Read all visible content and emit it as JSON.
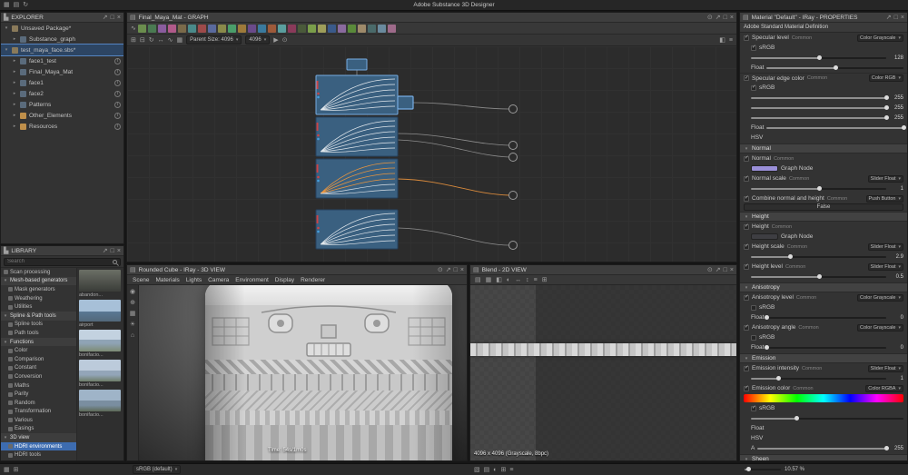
{
  "app": {
    "title": "Adobe Substance 3D Designer"
  },
  "explorer": {
    "title": "EXPLORER",
    "items": [
      {
        "label": "Unsaved Package*"
      },
      {
        "label": "Substance_graph"
      },
      {
        "label": "test_maya_face.sbs*"
      },
      {
        "label": "face1_test"
      },
      {
        "label": "Final_Maya_Mat"
      },
      {
        "label": "face1"
      },
      {
        "label": "face2"
      },
      {
        "label": "Patterns"
      },
      {
        "label": "Other_Elements"
      },
      {
        "label": "Resources"
      }
    ]
  },
  "library": {
    "title": "LIBRARY",
    "search_placeholder": "Search",
    "items": [
      {
        "label": "Scan processing"
      },
      {
        "label": "Mesh-based generators"
      },
      {
        "label": "Mask generators"
      },
      {
        "label": "Weathering"
      },
      {
        "label": "Utilities"
      },
      {
        "label": "Spline & Path tools"
      },
      {
        "label": "Spline tools"
      },
      {
        "label": "Path tools"
      },
      {
        "label": "Functions"
      },
      {
        "label": "Color"
      },
      {
        "label": "Comparison"
      },
      {
        "label": "Constant"
      },
      {
        "label": "Conversion"
      },
      {
        "label": "Maths"
      },
      {
        "label": "Parity"
      },
      {
        "label": "Random"
      },
      {
        "label": "Transformation"
      },
      {
        "label": "Various"
      },
      {
        "label": "Easings"
      },
      {
        "label": "3D view"
      },
      {
        "label": "HDRI environments"
      },
      {
        "label": "HDRI tools"
      }
    ],
    "thumbs": [
      {
        "label": "abandon..."
      },
      {
        "label": "airport"
      },
      {
        "label": "bonifacio..."
      },
      {
        "label": "bonifacio..."
      },
      {
        "label": "bonifacio..."
      }
    ]
  },
  "graph": {
    "tab_title": "Final_Maya_Mat - GRAPH",
    "parent_size_label": "Parent Size: 4096",
    "size_value": "4096"
  },
  "view3d": {
    "tab_title": "Rounded Cube - IRay - 3D VIEW",
    "menus": [
      {
        "label": "Scene"
      },
      {
        "label": "Materials"
      },
      {
        "label": "Lights"
      },
      {
        "label": "Camera"
      },
      {
        "label": "Environment"
      },
      {
        "label": "Display"
      },
      {
        "label": "Renderer"
      }
    ],
    "time_label": "Time: 54s/1m0s"
  },
  "view2d": {
    "tab_title": "Blend - 2D VIEW",
    "status": "4096 x 4096 (Grayscale, 8bpc)"
  },
  "properties": {
    "title": "Material \"Default\" - IRay - PROPERTIES",
    "subtitle": "Adobe Standard Material Definition",
    "labels": {
      "common": "Common",
      "srgb": "sRGB",
      "float": "Float",
      "hsv": "HSV",
      "alpha": "A"
    },
    "specular_level": {
      "label": "Specular level",
      "widget": "Color Grayscale",
      "value": "128"
    },
    "specular_edge": {
      "label": "Specular edge color",
      "widget": "Color RGB",
      "r": "255",
      "g": "255",
      "b": "255"
    },
    "normal_section": {
      "label": "Normal"
    },
    "normal": {
      "label": "Normal",
      "node": "Graph Node"
    },
    "normal_scale": {
      "label": "Normal scale",
      "widget": "Slider Float",
      "value": "1"
    },
    "combine": {
      "label": "Combine normal and height",
      "widget": "Push Button",
      "button": "False"
    },
    "height_section": {
      "label": "Height"
    },
    "height": {
      "label": "Height",
      "node": "Graph Node"
    },
    "height_scale": {
      "label": "Height scale",
      "widget": "Slider Float",
      "value": "2.9"
    },
    "height_level": {
      "label": "Height level",
      "widget": "Slider Float",
      "value": "0.5"
    },
    "aniso_section": {
      "label": "Anisotropy"
    },
    "aniso_level": {
      "label": "Anisotropy level",
      "widget": "Color Grayscale",
      "value": "0"
    },
    "aniso_angle": {
      "label": "Anisotropy angle",
      "widget": "Color Grayscale",
      "value": "0"
    },
    "emission_section": {
      "label": "Emission"
    },
    "emission_intensity": {
      "label": "Emission intensity",
      "widget": "Slider Float",
      "value": "1"
    },
    "emission_color": {
      "label": "Emission color",
      "widget": "Color RGBA",
      "alpha": "255"
    },
    "sheen_section": {
      "label": "Sheen"
    }
  },
  "statusbar": {
    "colorspace": "sRGB (default)",
    "zoom": "10.57 %"
  },
  "colors": {
    "accent": "#3d6cb0",
    "node_blue": "#3a6080",
    "curve_orange": "#e8953f"
  }
}
